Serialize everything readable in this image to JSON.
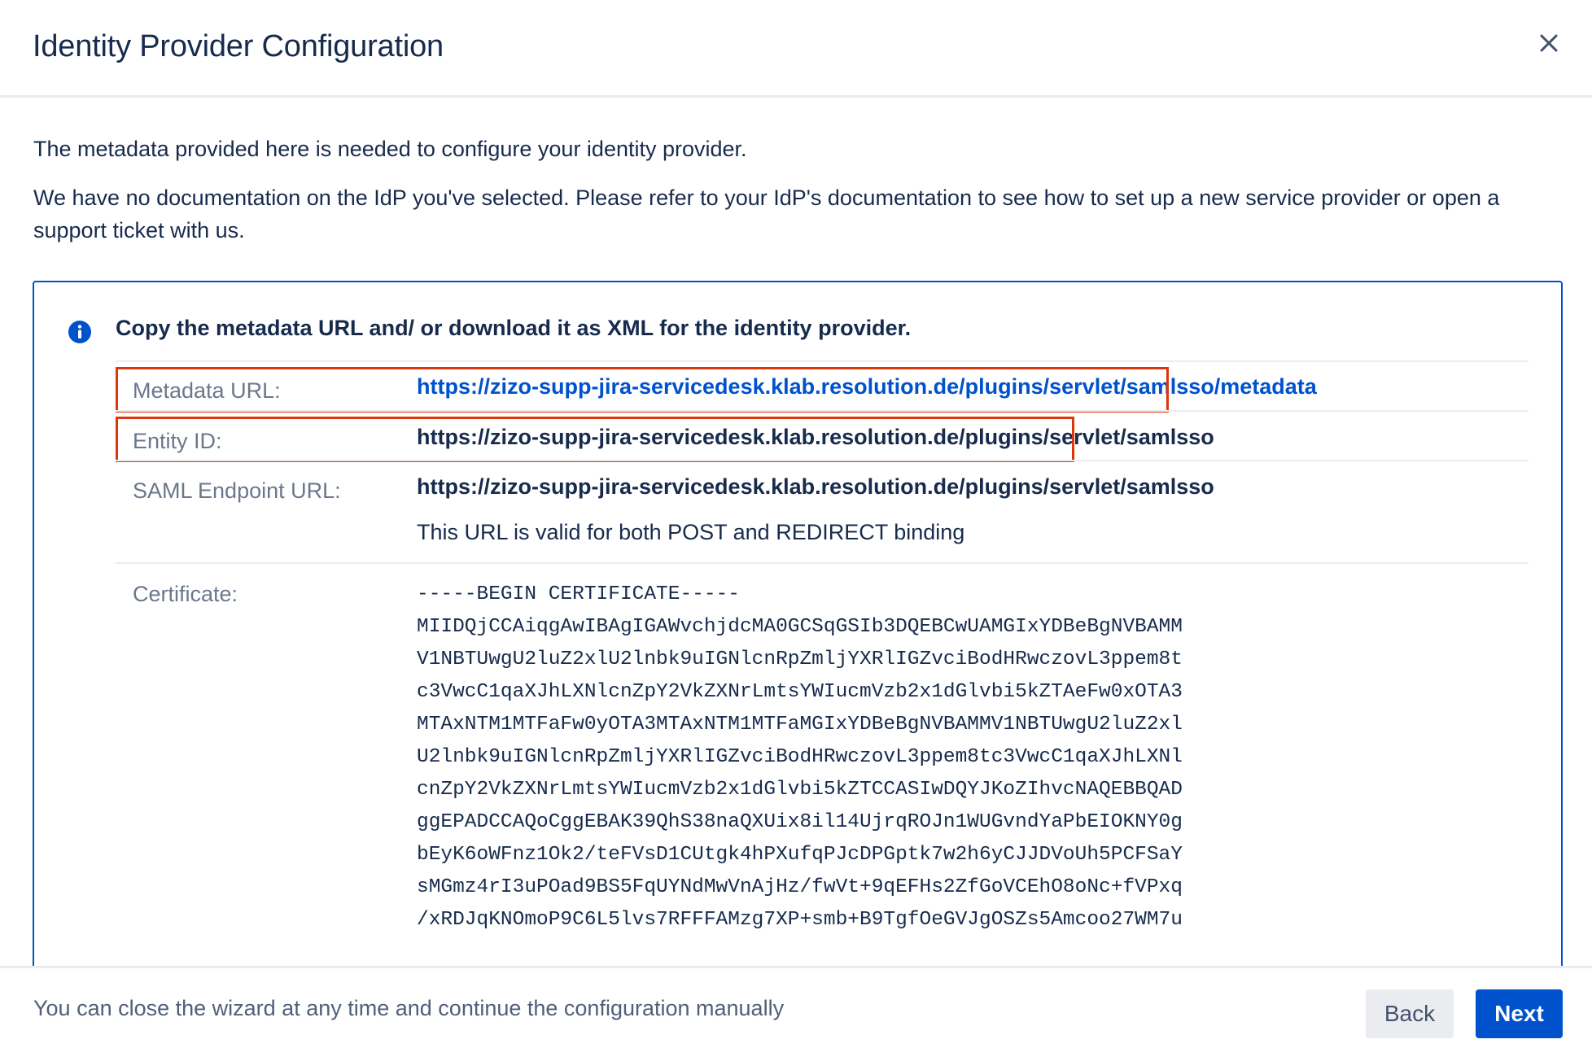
{
  "dialog": {
    "title": "Identity Provider Configuration",
    "close_icon": "close-icon"
  },
  "intro": {
    "line1": "The metadata provided here is needed to configure your identity provider.",
    "line2": "We have no documentation on the IdP you've selected. Please refer to your IdP's documentation to see how to set up a new service provider or open a support ticket with us."
  },
  "info": {
    "icon": "info-icon",
    "accent_color": "#0052cc",
    "heading": "Copy the metadata URL and/ or download it as XML for the identity provider."
  },
  "rows": {
    "metadata_url": {
      "label": "Metadata URL:",
      "value": "https://zizo-supp-jira-servicedesk.klab.resolution.de/plugins/servlet/samlsso/metadata"
    },
    "entity_id": {
      "label": "Entity ID:",
      "value": "https://zizo-supp-jira-servicedesk.klab.resolution.de/plugins/servlet/samlsso"
    },
    "saml_endpoint": {
      "label": "SAML Endpoint URL:",
      "value": "https://zizo-supp-jira-servicedesk.klab.resolution.de/plugins/servlet/samlsso",
      "note": "This URL is valid for both POST and REDIRECT binding"
    },
    "certificate": {
      "label": "Certificate:",
      "lines": [
        "-----BEGIN CERTIFICATE-----",
        "MIIDQjCCAiqgAwIBAgIGAWvchjdcMA0GCSqGSIb3DQEBCwUAMGIxYDBeBgNVBAMM",
        "V1NBTUwgU2luZ2xlU2lnbk9uIGNlcnRpZmljYXRlIGZvciBodHRwczovL3ppem8t",
        "c3VwcC1qaXJhLXNlcnZpY2VkZXNrLmtsYWIucmVzb2x1dGlvbi5kZTAeFw0xOTA3",
        "MTAxNTM1MTFaFw0yOTA3MTAxNTM1MTFaMGIxYDBeBgNVBAMMV1NBTUwgU2luZ2xl",
        "U2lnbk9uIGNlcnRpZmljYXRlIGZvciBodHRwczovL3ppem8tc3VwcC1qaXJhLXNl",
        "cnZpY2VkZXNrLmtsYWIucmVzb2x1dGlvbi5kZTCCASIwDQYJKoZIhvcNAQEBBQAD",
        "ggEPADCCAQoCggEBAK39QhS38naQXUix8il14UjrqROJn1WUGvndYaPbEIOKNY0g",
        "bEyK6oWFnz1Ok2/teFVsD1CUtgk4hPXufqPJcDPGptk7w2h6yCJJDVoUh5PCFSaY",
        "sMGmz4rI3uPOad9BS5FqUYNdMwVnAjHz/fwVt+9qEFHs2ZfGoVCEhO8oNc+fVPxq",
        "/xRDJqKNOmoP9C6L5lvs7RFFFAMzg7XP+smb+B9TgfOeGVJgOSZs5Amcoo27WM7u"
      ]
    }
  },
  "highlight_color": "#de350b",
  "footer": {
    "text": "You can close the wizard at any time and continue the configuration manually",
    "back_label": "Back",
    "next_label": "Next"
  }
}
